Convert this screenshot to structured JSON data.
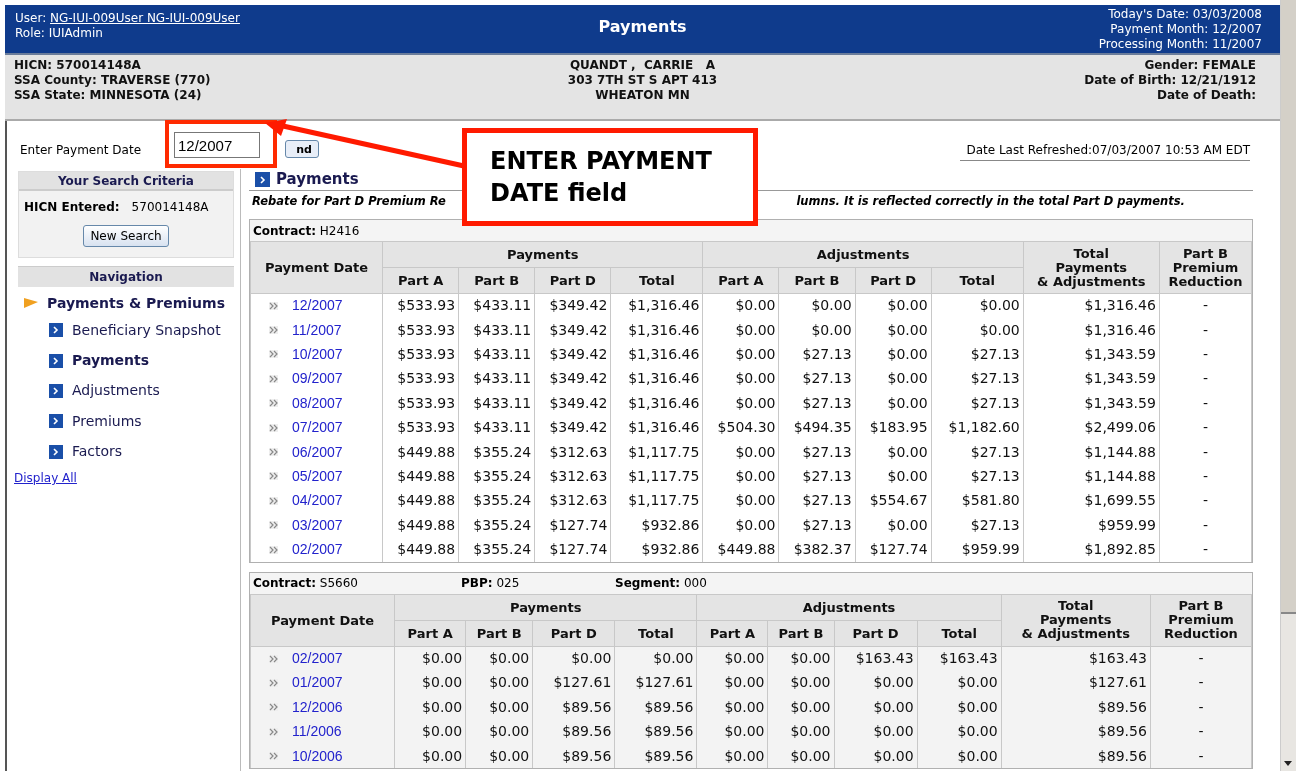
{
  "header": {
    "user_label": "User:",
    "user": "NG-IUI-009User NG-IUI-009User",
    "role": "Role: IUIAdmin",
    "title": "Payments",
    "dates": [
      "Today's Date: 03/03/2008",
      "Payment Month: 12/2007",
      "Processing Month: 11/2007"
    ]
  },
  "beneficiary": {
    "left": [
      "HICN: 570014148A",
      "SSA County: TRAVERSE (770)",
      "SSA State: MINNESOTA (24)"
    ],
    "center": [
      "QUANDT ,  CARRIE   A",
      "303 7TH ST S APT 413",
      "WHEATON MN"
    ],
    "right": [
      "Gender: FEMALE",
      "Date of Birth: 12/21/1912",
      "Date of Death:"
    ]
  },
  "search": {
    "label": "Enter Payment Date",
    "value": "12/2007",
    "button": "nd"
  },
  "refreshed": "Date Last Refreshed:07/03/2007 10:53 AM EDT",
  "criteria": {
    "title": "Your Search Criteria",
    "hicn_label": "HICN Entered:",
    "hicn": "570014148A",
    "button": "New Search"
  },
  "navigation": {
    "title": "Navigation",
    "items": [
      {
        "label": "Payments & Premiums",
        "expanded": true,
        "children": [
          {
            "label": "Beneficiary Snapshot",
            "selected": false
          },
          {
            "label": "Payments",
            "selected": true
          },
          {
            "label": "Adjustments",
            "selected": false
          },
          {
            "label": "Premiums",
            "selected": false
          },
          {
            "label": "Factors",
            "selected": false
          }
        ]
      }
    ],
    "display_all": "Display All"
  },
  "section_title": "Payments",
  "note": [
    "Rebate for Part D Premium Re",
    "lumns. It is reflected correctly in the total Part D payments."
  ],
  "tables": [
    {
      "contract_label": "Contract:",
      "contract": "H2416",
      "headers": {
        "date": "Payment Date",
        "groups": [
          {
            "label": "Payments",
            "columns": [
              "Part A",
              "Part B",
              "Part D",
              "Total"
            ]
          },
          {
            "label": "Adjustments",
            "columns": [
              "Part A",
              "Part B",
              "Part D",
              "Total"
            ]
          }
        ],
        "extra": [
          "Total\nPayments\n& Adjustments",
          "Part B\nPremium\nReduction"
        ]
      },
      "rows": [
        {
          "date": "12/2007",
          "cells": [
            "$533.93",
            "$433.11",
            "$349.42",
            "$1,316.46",
            "$0.00",
            "$0.00",
            "$0.00",
            "$0.00",
            "$1,316.46",
            "-"
          ]
        },
        {
          "date": "11/2007",
          "cells": [
            "$533.93",
            "$433.11",
            "$349.42",
            "$1,316.46",
            "$0.00",
            "$0.00",
            "$0.00",
            "$0.00",
            "$1,316.46",
            "-"
          ]
        },
        {
          "date": "10/2007",
          "cells": [
            "$533.93",
            "$433.11",
            "$349.42",
            "$1,316.46",
            "$0.00",
            "$27.13",
            "$0.00",
            "$27.13",
            "$1,343.59",
            "-"
          ]
        },
        {
          "date": "09/2007",
          "cells": [
            "$533.93",
            "$433.11",
            "$349.42",
            "$1,316.46",
            "$0.00",
            "$27.13",
            "$0.00",
            "$27.13",
            "$1,343.59",
            "-"
          ]
        },
        {
          "date": "08/2007",
          "cells": [
            "$533.93",
            "$433.11",
            "$349.42",
            "$1,316.46",
            "$0.00",
            "$27.13",
            "$0.00",
            "$27.13",
            "$1,343.59",
            "-"
          ]
        },
        {
          "date": "07/2007",
          "cells": [
            "$533.93",
            "$433.11",
            "$349.42",
            "$1,316.46",
            "$504.30",
            "$494.35",
            "$183.95",
            "$1,182.60",
            "$2,499.06",
            "-"
          ]
        },
        {
          "date": "06/2007",
          "cells": [
            "$449.88",
            "$355.24",
            "$312.63",
            "$1,117.75",
            "$0.00",
            "$27.13",
            "$0.00",
            "$27.13",
            "$1,144.88",
            "-"
          ]
        },
        {
          "date": "05/2007",
          "cells": [
            "$449.88",
            "$355.24",
            "$312.63",
            "$1,117.75",
            "$0.00",
            "$27.13",
            "$0.00",
            "$27.13",
            "$1,144.88",
            "-"
          ]
        },
        {
          "date": "04/2007",
          "cells": [
            "$449.88",
            "$355.24",
            "$312.63",
            "$1,117.75",
            "$0.00",
            "$27.13",
            "$554.67",
            "$581.80",
            "$1,699.55",
            "-"
          ]
        },
        {
          "date": "03/2007",
          "cells": [
            "$449.88",
            "$355.24",
            "$127.74",
            "$932.86",
            "$0.00",
            "$27.13",
            "$0.00",
            "$27.13",
            "$959.99",
            "-"
          ]
        },
        {
          "date": "02/2007",
          "cells": [
            "$449.88",
            "$355.24",
            "$127.74",
            "$932.86",
            "$449.88",
            "$382.37",
            "$127.74",
            "$959.99",
            "$1,892.85",
            "-"
          ]
        }
      ]
    },
    {
      "contract_label": "Contract:",
      "contract": "S5660",
      "pbp_label": "PBP:",
      "pbp": "025",
      "segment_label": "Segment:",
      "segment": "000",
      "headers": {
        "date": "Payment Date",
        "groups": [
          {
            "label": "Payments",
            "columns": [
              "Part A",
              "Part B",
              "Part D",
              "Total"
            ]
          },
          {
            "label": "Adjustments",
            "columns": [
              "Part A",
              "Part B",
              "Part D",
              "Total"
            ]
          }
        ],
        "extra": [
          "Total\nPayments\n& Adjustments",
          "Part B\nPremium\nReduction"
        ]
      },
      "rows": [
        {
          "date": "02/2007",
          "cells": [
            "$0.00",
            "$0.00",
            "$0.00",
            "$0.00",
            "$0.00",
            "$0.00",
            "$163.43",
            "$163.43",
            "$163.43",
            "-"
          ]
        },
        {
          "date": "01/2007",
          "cells": [
            "$0.00",
            "$0.00",
            "$127.61",
            "$127.61",
            "$0.00",
            "$0.00",
            "$0.00",
            "$0.00",
            "$127.61",
            "-"
          ]
        },
        {
          "date": "12/2006",
          "cells": [
            "$0.00",
            "$0.00",
            "$89.56",
            "$89.56",
            "$0.00",
            "$0.00",
            "$0.00",
            "$0.00",
            "$89.56",
            "-"
          ]
        },
        {
          "date": "11/2006",
          "cells": [
            "$0.00",
            "$0.00",
            "$89.56",
            "$89.56",
            "$0.00",
            "$0.00",
            "$0.00",
            "$0.00",
            "$89.56",
            "-"
          ]
        },
        {
          "date": "10/2006",
          "cells": [
            "$0.00",
            "$0.00",
            "$89.56",
            "$89.56",
            "$0.00",
            "$0.00",
            "$0.00",
            "$0.00",
            "$89.56",
            "-"
          ]
        }
      ]
    }
  ],
  "callout": {
    "text": "ENTER PAYMENT DATE field"
  }
}
